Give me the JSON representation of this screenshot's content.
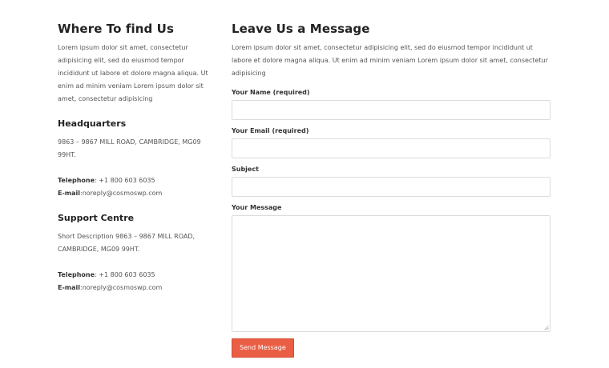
{
  "left": {
    "title": "Where To find Us",
    "intro": "Lorem ipsum dolor sit amet, consectetur adipisicing elit, sed do eiusmod tempor incididunt ut labore et dolore magna aliqua. Ut enim ad minim veniam Lorem ipsum dolor sit amet, consectetur adipisicing",
    "headquarters": {
      "heading": "Headquarters",
      "address": "9863 – 9867 MILL ROAD, CAMBRIDGE, MG09 99HT.",
      "telephone_label": "Telephone",
      "telephone_value": ": +1 800 603 6035",
      "email_label": "E-mail",
      "email_value": ":noreply@cosmoswp.com"
    },
    "support": {
      "heading": "Support Centre",
      "description": "Short Description 9863 – 9867 MILL ROAD, CAMBRIDGE, MG09 99HT.",
      "telephone_label": "Telephone",
      "telephone_value": ": +1 800 603 6035",
      "email_label": "E-mail",
      "email_value": ":noreply@cosmoswp.com"
    }
  },
  "form": {
    "title": "Leave Us a Message",
    "intro": "Lorem ipsum dolor sit amet, consectetur adipisicing elit, sed do eiusmod tempor incididunt ut labore et dolore magna aliqua. Ut enim ad minim veniam Lorem ipsum dolor sit amet, consectetur adipisicing",
    "name_label": "Your Name (required)",
    "name_value": "",
    "email_label": "Your Email (required)",
    "email_value": "",
    "subject_label": "Subject",
    "subject_value": "",
    "message_label": "Your Message",
    "message_value": "",
    "submit_label": "Send Message"
  },
  "colors": {
    "button_bg": "#ea5e45",
    "heading": "#222222",
    "body_text": "#555555"
  },
  "icons": {
    "textarea_resize": "resize-handle-icon"
  }
}
